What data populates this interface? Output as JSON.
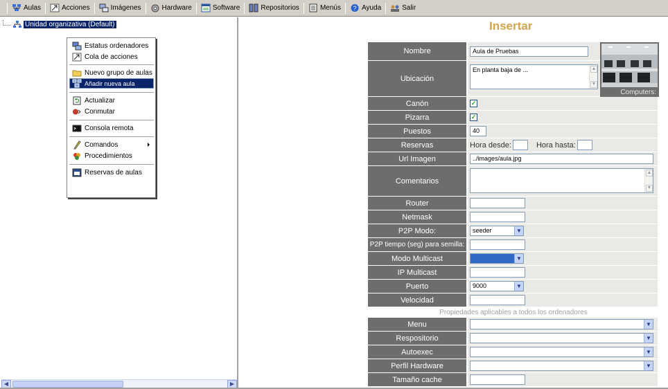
{
  "toolbar": {
    "items": [
      {
        "label": "Aulas",
        "icon": "classrooms-icon"
      },
      {
        "label": "Acciones",
        "icon": "actions-icon"
      },
      {
        "label": "Imágenes",
        "icon": "images-icon"
      },
      {
        "label": "Hardware",
        "icon": "hardware-icon"
      },
      {
        "label": "Software",
        "icon": "software-icon"
      },
      {
        "label": "Repositorios",
        "icon": "repositories-icon"
      },
      {
        "label": "Menús",
        "icon": "menus-icon"
      },
      {
        "label": "Ayuda",
        "icon": "help-icon"
      },
      {
        "label": "Salir",
        "icon": "exit-icon"
      }
    ]
  },
  "tree": {
    "root_label": "Unidad organizativa (Default)"
  },
  "context_menu": {
    "items": [
      {
        "label": "Estatus ordenadores",
        "icon": "computer-status-icon"
      },
      {
        "label": "Cola de acciones",
        "icon": "action-queue-icon"
      },
      {
        "label": "Nuevo grupo de aulas",
        "icon": "folder-icon"
      },
      {
        "label": "Añadir nueva aula",
        "icon": "add-classroom-icon",
        "selected": true
      },
      {
        "label": "Actualizar",
        "icon": "refresh-icon"
      },
      {
        "label": "Conmutar",
        "icon": "switch-icon"
      },
      {
        "label": "Consola remota",
        "icon": "console-icon"
      },
      {
        "label": "Comandos",
        "icon": "commands-icon",
        "submenu": true
      },
      {
        "label": "Procedimientos",
        "icon": "procedures-icon"
      },
      {
        "label": "Reservas de aulas",
        "icon": "reservations-icon"
      }
    ]
  },
  "form": {
    "title": "Insertar",
    "fields": {
      "nombre": {
        "label": "Nombre",
        "value": "Aula de Pruebas"
      },
      "ubicacion": {
        "label": "Ubicación",
        "value": "En planta baja de ..."
      },
      "canon": {
        "label": "Canón",
        "checked": true
      },
      "pizarra": {
        "label": "Pizarra",
        "checked": true
      },
      "puestos": {
        "label": "Puestos",
        "value": "40"
      },
      "reservas": {
        "label": "Reservas",
        "desde_label": "Hora desde:",
        "hasta_label": "Hora hasta:"
      },
      "url_imagen": {
        "label": "Url Imagen",
        "value": "../images/aula.jpg"
      },
      "comentarios": {
        "label": "Comentarios",
        "value": ""
      },
      "router": {
        "label": "Router",
        "value": ""
      },
      "netmask": {
        "label": "Netmask",
        "value": ""
      },
      "p2p_modo": {
        "label": "P2P Modo:",
        "value": "seeder"
      },
      "p2p_tiempo": {
        "label": "P2P tiempo (seg) para semilla:",
        "value": ""
      },
      "modo_multicast": {
        "label": "Modo Multicast",
        "value": ""
      },
      "ip_multicast": {
        "label": "IP Multicast",
        "value": ""
      },
      "puerto": {
        "label": "Puerto",
        "value": "9000"
      },
      "velocidad": {
        "label": "Velocidad",
        "value": ""
      }
    },
    "section_label": "Propiedades aplicables a todos los ordenadores",
    "props": {
      "menu": {
        "label": "Menu",
        "value": ""
      },
      "repositorio": {
        "label": "Respositorio",
        "value": ""
      },
      "autoexec": {
        "label": "Autoexec",
        "value": ""
      },
      "perfil_hardware": {
        "label": "Perfil Hardware",
        "value": ""
      },
      "tamano_cache": {
        "label": "Tamaño cache",
        "value": ""
      }
    },
    "photo_caption": "Computers:"
  },
  "colors": {
    "label_bg": "#6d6d6d",
    "value_bg": "#ebe9e5",
    "title": "#d6a44a",
    "selection": "#0a246a",
    "toolbar_bg": "#d4d0c8"
  }
}
